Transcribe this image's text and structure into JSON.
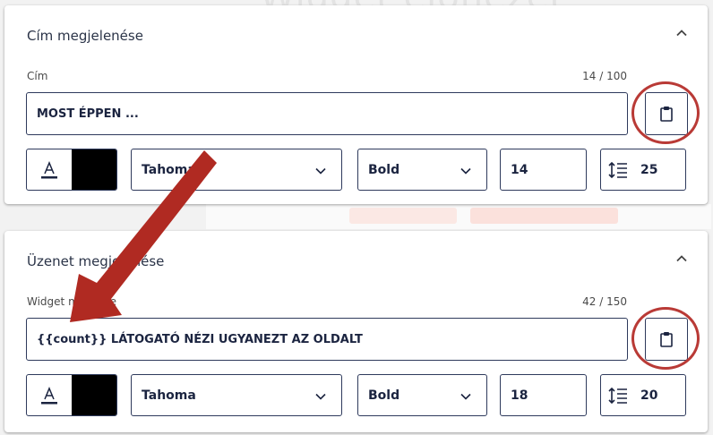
{
  "background": {
    "heading": "Widget előnézet"
  },
  "sections": [
    {
      "title": "Cím megjelenése",
      "field_label": "Cím",
      "counter": "14 / 100",
      "text_value": "MOST ÉPPEN ...",
      "text_color": "#000000",
      "font_family": "Tahoma",
      "font_weight": "Bold",
      "font_size": "14",
      "line_height": "25"
    },
    {
      "title": "Üzenet megjelenése",
      "field_label": "Widget message",
      "counter": "42 / 150",
      "text_value": "{{count}} LÁTOGATÓ NÉZI UGYANEZT AZ OLDALT",
      "text_color": "#000000",
      "font_family": "Tahoma",
      "font_weight": "Bold",
      "font_size": "18",
      "line_height": "20"
    }
  ],
  "annotation": {
    "arrow_color": "#b02a22",
    "circle_color": "#b93a36"
  },
  "icons": {
    "collapse": "chevron-up-icon",
    "paste": "clipboard-icon",
    "text_color": "text-color-icon",
    "dropdown": "chevron-down-icon",
    "line_height": "line-height-icon"
  }
}
